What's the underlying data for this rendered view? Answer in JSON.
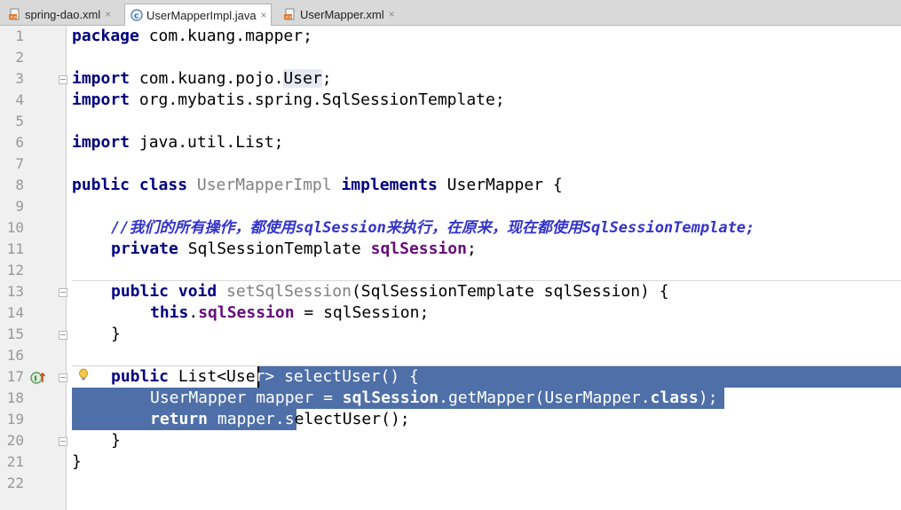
{
  "tabs": [
    {
      "label": "spring-dao.xml",
      "icon": "xml-file-icon"
    },
    {
      "label": "UserMapperImpl.java",
      "icon": "java-class-icon",
      "active": true
    },
    {
      "label": "UserMapper.xml",
      "icon": "xml-file-icon"
    }
  ],
  "tab_close": "×",
  "line_numbers": [
    "1",
    "2",
    "3",
    "4",
    "5",
    "6",
    "7",
    "8",
    "9",
    "10",
    "11",
    "12",
    "13",
    "14",
    "15",
    "16",
    "17",
    "18",
    "19",
    "20",
    "21",
    "22"
  ],
  "code": {
    "l1_kw": "package",
    "l1_rest": " com.kuang.mapper;",
    "l3_kw": "import",
    "l3_a": " com.kuang.pojo.",
    "l3_b": "User",
    "l3_c": ";",
    "l4_kw": "import",
    "l4_rest": " org.mybatis.spring.SqlSessionTemplate;",
    "l6_kw": "import",
    "l6_rest": " java.util.List;",
    "l8_kw1": "public class",
    "l8_cls": " UserMapperImpl",
    "l8_kw2": " implements",
    "l8_rest": " UserMapper {",
    "l10_comment": "//我们的所有操作，都使用sqlSession来执行，在原来，现在都使用SqlSessionTemplate;",
    "l11_kw": "private",
    "l11_a": " SqlSessionTemplate ",
    "l11_field": "sqlSession",
    "l11_c": ";",
    "l13_kw": "public void",
    "l13_m": " setSqlSession",
    "l13_rest": "(SqlSessionTemplate sqlSession) {",
    "l14_kw": "this",
    "l14_a": ".",
    "l14_field": "sqlSession",
    "l14_rest": " = sqlSession;",
    "l15": "}",
    "l17_kw": "public",
    "l17_a": " List<Use",
    "l17_b": "r> selectUser() {",
    "l18_a": "UserMapper mapper = ",
    "l18_field": "sqlSession",
    "l18_b": ".getMapper(UserMapper.",
    "l18_kw": "class",
    "l18_c": ");",
    "l19_kw": "return",
    "l19_a": " mapper.s",
    "l19_b": "electUser();",
    "l20": "}",
    "l21": "}"
  },
  "colors": {
    "keyword": "#000080",
    "field": "#660e7a",
    "comment": "#3333cc",
    "selection": "#4e6fa8",
    "gutter": "#f0f0f0"
  },
  "gutter_icons": [
    "implements-method-icon",
    "intention-bulb-icon"
  ]
}
